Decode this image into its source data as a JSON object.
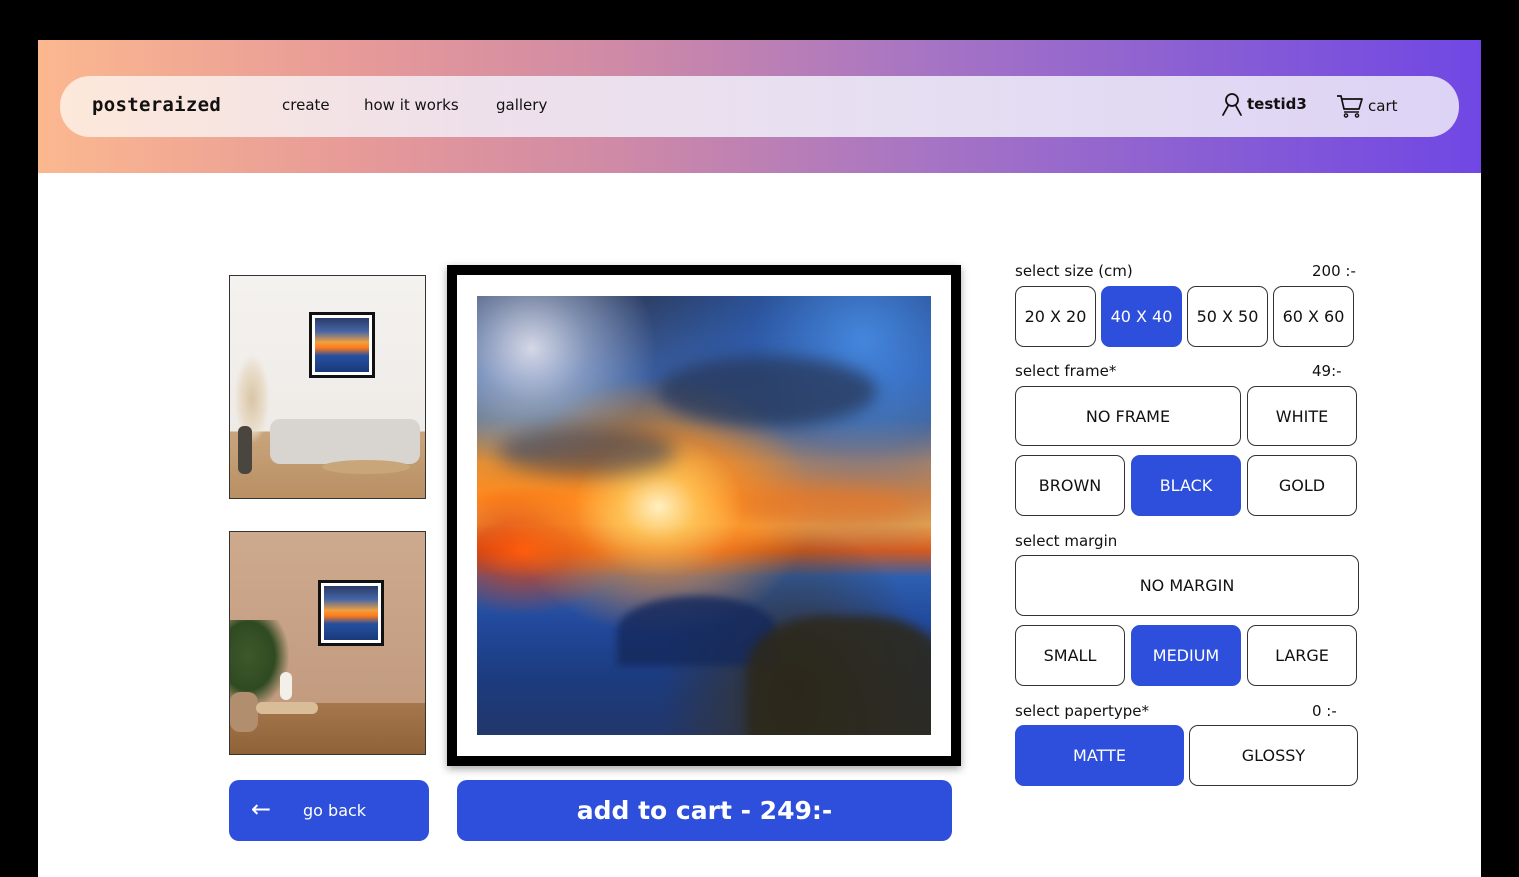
{
  "nav": {
    "logo": "posteraized",
    "links": [
      "create",
      "how it works",
      "gallery"
    ],
    "user": "testid3",
    "cart": "cart"
  },
  "buttons": {
    "back": "go back",
    "add_to_cart": "add to cart - 249:-"
  },
  "options": {
    "size": {
      "label": "select size (cm)",
      "price": "200 :-",
      "items": [
        "20 X 20",
        "40 X 40",
        "50 X 50",
        "60 X 60"
      ],
      "selected": "40 X 40"
    },
    "frame": {
      "label": "select frame*",
      "price": "49:-",
      "items": [
        "NO FRAME",
        "WHITE",
        "BROWN",
        "BLACK",
        "GOLD"
      ],
      "selected": "BLACK"
    },
    "margin": {
      "label": "select margin",
      "items": [
        "NO MARGIN",
        "SMALL",
        "MEDIUM",
        "LARGE"
      ],
      "selected": "MEDIUM"
    },
    "papertype": {
      "label": "select papertype*",
      "price": "0 :-",
      "items": [
        "MATTE",
        "GLOSSY"
      ],
      "selected": "MATTE"
    }
  },
  "colors": {
    "accent": "#2d4fdb"
  }
}
